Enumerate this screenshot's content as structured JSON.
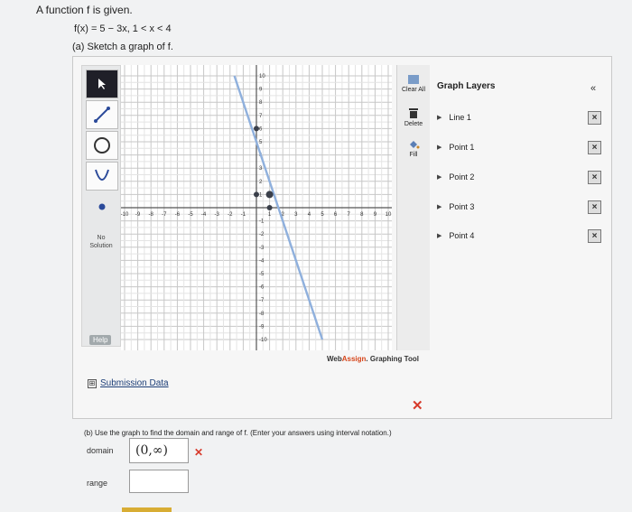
{
  "problem": {
    "intro": "A function f is given.",
    "function_text": "f(x) = 5 − 3x,   1 < x < 4",
    "part_a": "(a) Sketch a graph of f."
  },
  "toolbar": {
    "no_solution_line1": "No",
    "no_solution_line2": "Solution",
    "help_label": "Help"
  },
  "side_buttons": {
    "clear_all": "Clear All",
    "delete": "Delete",
    "fill": "Fill"
  },
  "graph": {
    "x_ticks": [
      "-10",
      "-9",
      "-8",
      "-7",
      "-6",
      "-5",
      "-4",
      "-3",
      "-2",
      "-1",
      "1",
      "2",
      "3",
      "4",
      "5",
      "6",
      "7",
      "8",
      "9",
      "10"
    ],
    "y_ticks": [
      "10",
      "9",
      "8",
      "7",
      "6",
      "5",
      "4",
      "3",
      "2",
      "1",
      "-1",
      "-2",
      "-3",
      "-4",
      "-5",
      "-6",
      "-7",
      "-8",
      "-9",
      "-10"
    ],
    "line": {
      "x1": -1.67,
      "y1": 10,
      "x2": 5,
      "y2": -10
    },
    "points": [
      {
        "x": 0,
        "y": 6
      },
      {
        "x": 0,
        "y": 1
      },
      {
        "x": 1,
        "y": 1
      },
      {
        "x": 1,
        "y": 0
      }
    ],
    "branding_a": "Web",
    "branding_b": "Assign",
    "branding_c": ". Graphing Tool"
  },
  "layers": {
    "title": "Graph Layers",
    "collapse": "«",
    "items": [
      "Line 1",
      "Point 1",
      "Point 2",
      "Point 3",
      "Point 4"
    ]
  },
  "submission": {
    "box": "⊞",
    "label": "Submission Data"
  },
  "feedback": {
    "mark": "✕"
  },
  "part_b": {
    "text": "(b) Use the graph to find the domain and range of f. (Enter your answers using interval notation.)",
    "domain_label": "domain",
    "domain_value": "(0,∞)",
    "domain_mark": "✕",
    "range_label": "range",
    "range_value": ""
  }
}
